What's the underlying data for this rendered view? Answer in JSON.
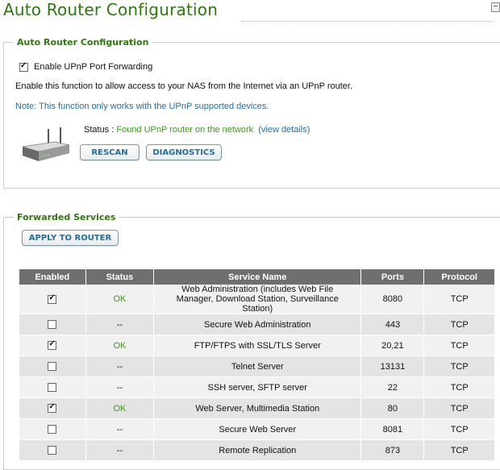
{
  "page": {
    "title": "Auto Router Configuration"
  },
  "upnp_section": {
    "legend": "Auto Router Configuration",
    "enable_label": "Enable UPnP Port Forwarding",
    "enable_checked": true,
    "description": "Enable this function to allow access to your NAS from the Internet via an UPnP router.",
    "note": "Note: This function only works with the UPnP supported devices.",
    "status_label": "Status :",
    "status_value": "Found UPnP router on the network",
    "view_details": "(view details)",
    "rescan_label": "RESCAN",
    "diagnostics_label": "DIAGNOSTICS"
  },
  "forwarded_section": {
    "legend": "Forwarded Services",
    "apply_label": "APPLY TO ROUTER",
    "columns": [
      "Enabled",
      "Status",
      "Service Name",
      "Ports",
      "Protocol"
    ],
    "rows": [
      {
        "enabled": true,
        "status": "OK",
        "service": "Web Administration (includes Web File Manager, Download Station, Surveillance Station)",
        "ports": "8080",
        "protocol": "TCP"
      },
      {
        "enabled": false,
        "status": "--",
        "service": "Secure Web Administration",
        "ports": "443",
        "protocol": "TCP"
      },
      {
        "enabled": true,
        "status": "OK",
        "service": "FTP/FTPS with SSL/TLS Server",
        "ports": "20,21",
        "protocol": "TCP"
      },
      {
        "enabled": false,
        "status": "--",
        "service": "Telnet Server",
        "ports": "13131",
        "protocol": "TCP"
      },
      {
        "enabled": false,
        "status": "--",
        "service": "SSH server, SFTP server",
        "ports": "22",
        "protocol": "TCP"
      },
      {
        "enabled": true,
        "status": "OK",
        "service": "Web Server, Multimedia Station",
        "ports": "80",
        "protocol": "TCP"
      },
      {
        "enabled": false,
        "status": "--",
        "service": "Secure Web Server",
        "ports": "8081",
        "protocol": "TCP"
      },
      {
        "enabled": false,
        "status": "--",
        "service": "Remote Replication",
        "ports": "873",
        "protocol": "TCP"
      }
    ]
  },
  "colors": {
    "title_green": "#2b7a0b",
    "ok_green": "#3a9a1a",
    "link_blue": "#1e6fa6",
    "header_gray": "#6f6f6f"
  },
  "icons": [
    "router-icon",
    "window-corner-icon",
    "checkbox-icon"
  ]
}
